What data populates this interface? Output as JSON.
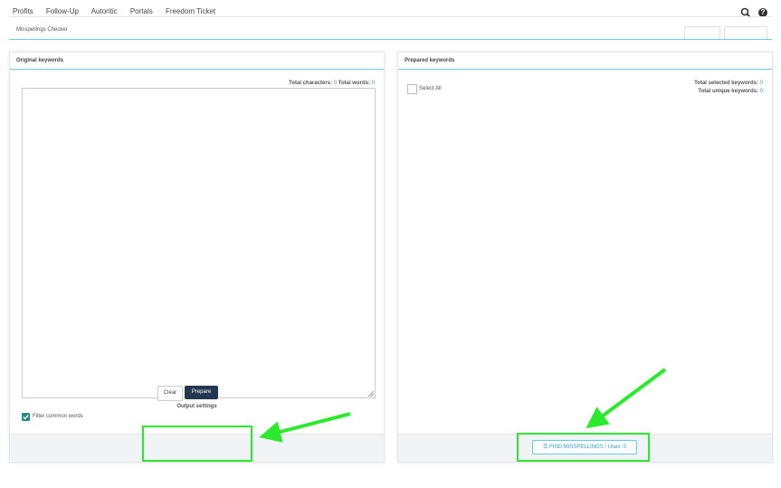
{
  "topnav": {
    "items": [
      "Profits",
      "Follow-Up",
      "Autoritic",
      "Portals",
      "Freedom Ticket"
    ]
  },
  "page": {
    "title": "Misspellings Checker"
  },
  "left_panel": {
    "title": "Original keywords",
    "total_characters_label": "Total characters:",
    "total_characters_value": "0",
    "total_words_label": "Total words:",
    "total_words_value": "0",
    "textarea_value": "",
    "output_settings_label": "Output settings",
    "filter_common_words_label": "Filter common words",
    "filter_common_words_checked": true,
    "clear_label": "Clear",
    "prepare_label": "Prepare"
  },
  "right_panel": {
    "title": "Prepared keywords",
    "select_all_label": "Select All",
    "total_selected_label": "Total selected keywords:",
    "total_selected_value": "0",
    "total_unique_label": "Total unique keywords:",
    "total_unique_value": "0",
    "find_button_label": "FIND MISSPELLINGS / Uses: 0"
  },
  "colors": {
    "accent": "#2d9fd8",
    "prepare_button": "#23384f",
    "highlight": "#2bea2b",
    "checkbox": "#2a8a8a"
  },
  "icons": {
    "search": "search-icon",
    "help": "help-icon",
    "list": "list-icon",
    "check": "check-icon"
  }
}
